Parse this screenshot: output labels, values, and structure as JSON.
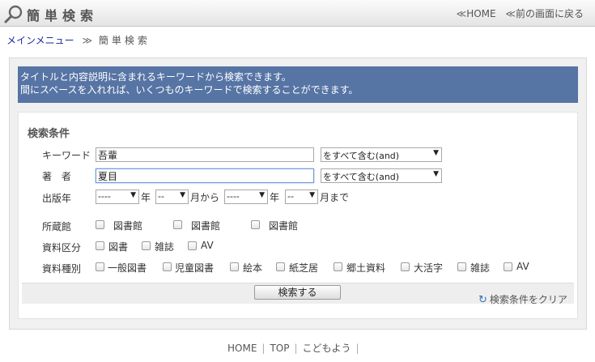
{
  "header": {
    "title": "簡単検索",
    "home_link": "HOME",
    "back_link": "前の画面に戻る",
    "chevron": "≪"
  },
  "breadcrumb": {
    "menu_link": "メインメニュー",
    "separator": "≫",
    "current": "簡単検索"
  },
  "info": {
    "line1": "タイトルと内容説明に含まれるキーワードから検索できます。",
    "line2": "間にスペースを入れれば、いくつものキーワードで検索することができます。"
  },
  "form": {
    "section_title": "検索条件",
    "keyword": {
      "label": "キーワード",
      "value": "吾輩",
      "mode": "をすべて含む(and)"
    },
    "author": {
      "label": "著 者",
      "value": "夏目",
      "mode": "をすべて含む(and)"
    },
    "pubyear": {
      "label": "出版年",
      "from_year": "----",
      "year_unit1": "年",
      "from_month": "--",
      "month_unit1": "月から",
      "to_year": "----",
      "year_unit2": "年",
      "to_month": "--",
      "month_unit2": "月まで"
    },
    "library": {
      "label": "所蔵館",
      "options": [
        "図書館",
        "図書館",
        "図書館"
      ]
    },
    "material_class": {
      "label": "資料区分",
      "options": [
        "図書",
        "雑誌",
        "AV"
      ]
    },
    "material_type": {
      "label": "資料種別",
      "options": [
        "一般図書",
        "児童図書",
        "絵本",
        "紙芝居",
        "郷土資料",
        "大活字",
        "雑誌",
        "AV"
      ]
    },
    "search_button": "検索する",
    "clear_link": "検索条件をクリア"
  },
  "footer": {
    "home": "HOME",
    "top": "TOP",
    "kids": "こどもよう",
    "separator": "|"
  }
}
